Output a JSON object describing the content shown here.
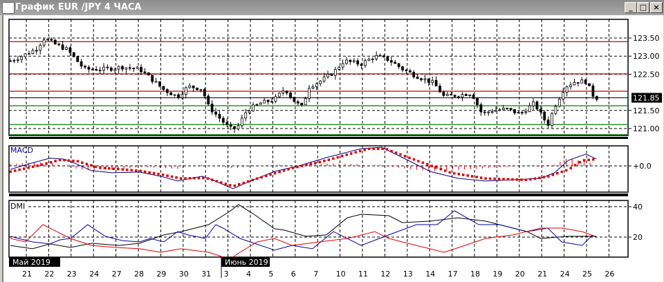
{
  "window": {
    "title": "График EUR /JPY  4 ЧАСА",
    "minimize": "_",
    "maximize": "□",
    "close": "×"
  },
  "colors": {
    "support": "#008000",
    "resistance": "#c00000",
    "macd": "#000080",
    "signal": "#e00000",
    "adx": "#000000",
    "plus_di": "#0000a0",
    "minus_di": "#e00000"
  },
  "chart_data": {
    "type": "candlestick",
    "title": "EUR/JPY 4H",
    "price_axis": {
      "ticks": [
        "123.50",
        "123.00",
        "122.50",
        "121.50",
        "121.00"
      ],
      "tick_values": [
        123.5,
        123.0,
        122.5,
        121.5,
        121.0
      ],
      "ylim": [
        120.78,
        123.85
      ],
      "current_price": "121.85"
    },
    "x_axis": {
      "day_labels": [
        "21",
        "22",
        "23",
        "24",
        "27",
        "28",
        "29",
        "30",
        "31",
        "3",
        "4",
        "5",
        "6",
        "7",
        "10",
        "11",
        "12",
        "13",
        "14",
        "17",
        "18",
        "19",
        "20",
        "21",
        "24",
        "25",
        "26"
      ],
      "month_labels": [
        "Май 2019",
        "Июнь 2019"
      ],
      "bars": 158
    },
    "horizontal_lines": [
      {
        "price": 123.4,
        "kind": "resistance"
      },
      {
        "price": 122.51,
        "kind": "resistance"
      },
      {
        "price": 122.03,
        "kind": "resistance"
      },
      {
        "price": 121.63,
        "kind": "support"
      },
      {
        "price": 121.11,
        "kind": "support"
      },
      {
        "price": 120.83,
        "kind": "support"
      }
    ],
    "price_path": [
      [
        0,
        122.87
      ],
      [
        3.1,
        123.0
      ],
      [
        6.9,
        123.2
      ],
      [
        9.1,
        123.5
      ],
      [
        11.5,
        123.35
      ],
      [
        15.2,
        123.18
      ],
      [
        19.8,
        122.64
      ],
      [
        25.4,
        122.64
      ],
      [
        30,
        122.7
      ],
      [
        34.6,
        122.64
      ],
      [
        37.4,
        122.4
      ],
      [
        41.1,
        122.07
      ],
      [
        44.8,
        121.88
      ],
      [
        47.6,
        122.16
      ],
      [
        51.3,
        122.1
      ],
      [
        53.1,
        121.6
      ],
      [
        55.9,
        121.3
      ],
      [
        58.7,
        121.0
      ],
      [
        60.6,
        121.0
      ],
      [
        63.3,
        121.5
      ],
      [
        67,
        121.7
      ],
      [
        70.7,
        121.8
      ],
      [
        73.5,
        122.1
      ],
      [
        76.3,
        121.72
      ],
      [
        78.1,
        121.6
      ],
      [
        80,
        122.16
      ],
      [
        82.8,
        122.3
      ],
      [
        86.5,
        122.55
      ],
      [
        89.3,
        122.87
      ],
      [
        93.9,
        122.78
      ],
      [
        97.6,
        123.0
      ],
      [
        101.3,
        122.9
      ],
      [
        105,
        122.64
      ],
      [
        108.7,
        122.45
      ],
      [
        113.3,
        122.26
      ],
      [
        116.1,
        121.88
      ],
      [
        119.8,
        121.92
      ],
      [
        123.5,
        121.98
      ],
      [
        126.3,
        121.4
      ],
      [
        129.1,
        121.5
      ],
      [
        132.8,
        121.54
      ],
      [
        136.5,
        121.4
      ],
      [
        140.2,
        121.7
      ],
      [
        143.9,
        121.1
      ],
      [
        145.7,
        121.6
      ],
      [
        148.5,
        122.16
      ],
      [
        151.3,
        122.3
      ],
      [
        154.1,
        122.3
      ],
      [
        156,
        121.92
      ],
      [
        156.9,
        121.85
      ]
    ],
    "macd": {
      "label": "MACD",
      "zero_label": "+0.0",
      "macd_line": [
        [
          0,
          -0.17
        ],
        [
          5,
          0.1
        ],
        [
          10.6,
          0.37
        ],
        [
          14.3,
          0.33
        ],
        [
          18,
          0.07
        ],
        [
          21.7,
          -0.23
        ],
        [
          27.2,
          -0.33
        ],
        [
          34.6,
          -0.3
        ],
        [
          40.2,
          -0.5
        ],
        [
          44.8,
          -0.73
        ],
        [
          51.3,
          -0.5
        ],
        [
          53.1,
          -0.6
        ],
        [
          59.6,
          -1.1
        ],
        [
          64.3,
          -0.73
        ],
        [
          70.7,
          -0.27
        ],
        [
          77.2,
          0
        ],
        [
          84.6,
          0.4
        ],
        [
          93.9,
          0.83
        ],
        [
          99.4,
          0.9
        ],
        [
          105,
          0.4
        ],
        [
          112.4,
          -0.27
        ],
        [
          119.8,
          -0.6
        ],
        [
          127.2,
          -0.73
        ],
        [
          134.6,
          -0.67
        ],
        [
          142,
          -0.6
        ],
        [
          145.7,
          -0.33
        ],
        [
          149.4,
          0.27
        ],
        [
          154.1,
          0.57
        ],
        [
          156.9,
          0.33
        ]
      ],
      "signal_line": [
        [
          0,
          -0.27
        ],
        [
          6.9,
          0
        ],
        [
          13.3,
          0.3
        ],
        [
          18,
          0.23
        ],
        [
          23.5,
          -0.07
        ],
        [
          34.6,
          -0.23
        ],
        [
          40.2,
          -0.4
        ],
        [
          45.7,
          -0.6
        ],
        [
          52.2,
          -0.57
        ],
        [
          59.6,
          -0.97
        ],
        [
          66.1,
          -0.6
        ],
        [
          75.4,
          -0.1
        ],
        [
          84.6,
          0.27
        ],
        [
          95.7,
          0.83
        ],
        [
          100.4,
          0.83
        ],
        [
          108.7,
          0.27
        ],
        [
          118,
          -0.33
        ],
        [
          127.2,
          -0.6
        ],
        [
          138.3,
          -0.67
        ],
        [
          143.9,
          -0.5
        ],
        [
          149.4,
          -0.17
        ],
        [
          153.1,
          0.27
        ],
        [
          156.9,
          0.33
        ]
      ]
    },
    "dmi": {
      "label": "DMI",
      "ticks": [
        "40",
        "20"
      ],
      "tick_values": [
        40,
        20
      ],
      "adx": [
        [
          0,
          14.5
        ],
        [
          5.9,
          12.3
        ],
        [
          10.6,
          15.5
        ],
        [
          16.1,
          13.2
        ],
        [
          21.7,
          15.9
        ],
        [
          29.1,
          14.5
        ],
        [
          34.6,
          15.9
        ],
        [
          41.1,
          21.4
        ],
        [
          45.7,
          23.6
        ],
        [
          53.1,
          28.2
        ],
        [
          58.7,
          36.8
        ],
        [
          61.1,
          41.4
        ],
        [
          65.2,
          35
        ],
        [
          70.7,
          25.5
        ],
        [
          73.5,
          24.5
        ],
        [
          79.1,
          20.5
        ],
        [
          84.6,
          21.4
        ],
        [
          90.2,
          32.7
        ],
        [
          93.9,
          35
        ],
        [
          101.3,
          34.1
        ],
        [
          105,
          29.5
        ],
        [
          112.4,
          30.5
        ],
        [
          119.8,
          32.7
        ],
        [
          127.2,
          30.5
        ],
        [
          134.6,
          25.9
        ],
        [
          138.3,
          23.6
        ],
        [
          142,
          19.1
        ],
        [
          149.4,
          20.5
        ],
        [
          156.9,
          20.5
        ]
      ],
      "plus_di": [
        [
          0,
          20.5
        ],
        [
          2.2,
          19.1
        ],
        [
          5.9,
          16.8
        ],
        [
          10.6,
          15.5
        ],
        [
          13.3,
          18.2
        ],
        [
          16.1,
          19.1
        ],
        [
          20.7,
          28.2
        ],
        [
          25.4,
          20.5
        ],
        [
          30,
          17.7
        ],
        [
          34.6,
          16.8
        ],
        [
          37.4,
          19.1
        ],
        [
          41.1,
          16.8
        ],
        [
          44.8,
          23.6
        ],
        [
          47.6,
          21.4
        ],
        [
          52.2,
          19.1
        ],
        [
          55,
          28.2
        ],
        [
          56.9,
          25.9
        ],
        [
          61.5,
          19.1
        ],
        [
          67,
          14.5
        ],
        [
          70.7,
          11.4
        ],
        [
          75.4,
          14.5
        ],
        [
          80.9,
          12.3
        ],
        [
          86.5,
          23.6
        ],
        [
          93.9,
          14.5
        ],
        [
          101.3,
          21.4
        ],
        [
          108.7,
          28.2
        ],
        [
          114.3,
          28.2
        ],
        [
          118.9,
          37.3
        ],
        [
          125.4,
          28.2
        ],
        [
          130.9,
          28.2
        ],
        [
          138.3,
          23.6
        ],
        [
          143.9,
          25.9
        ],
        [
          147.6,
          16.8
        ],
        [
          153.1,
          14.5
        ],
        [
          155.9,
          21.4
        ]
      ],
      "minus_di": [
        [
          0,
          19.1
        ],
        [
          4.1,
          16.8
        ],
        [
          8.7,
          28.2
        ],
        [
          12.4,
          23.6
        ],
        [
          16.1,
          19.1
        ],
        [
          21.7,
          14.5
        ],
        [
          28.1,
          13.2
        ],
        [
          34.6,
          12.3
        ],
        [
          40.2,
          10
        ],
        [
          45.7,
          12.3
        ],
        [
          53.1,
          10
        ],
        [
          58.7,
          5.5
        ],
        [
          61.5,
          10
        ],
        [
          66.1,
          16.8
        ],
        [
          70.7,
          19.1
        ],
        [
          75.4,
          14.5
        ],
        [
          82.8,
          16.8
        ],
        [
          90.2,
          19.1
        ],
        [
          97.6,
          23.6
        ],
        [
          101.3,
          19.1
        ],
        [
          108.7,
          14.5
        ],
        [
          116.1,
          10
        ],
        [
          121.7,
          14.5
        ],
        [
          127.2,
          19.1
        ],
        [
          134.6,
          21.4
        ],
        [
          142,
          25.9
        ],
        [
          147.6,
          25.9
        ],
        [
          153.1,
          23.6
        ],
        [
          156.5,
          20.5
        ]
      ]
    }
  }
}
